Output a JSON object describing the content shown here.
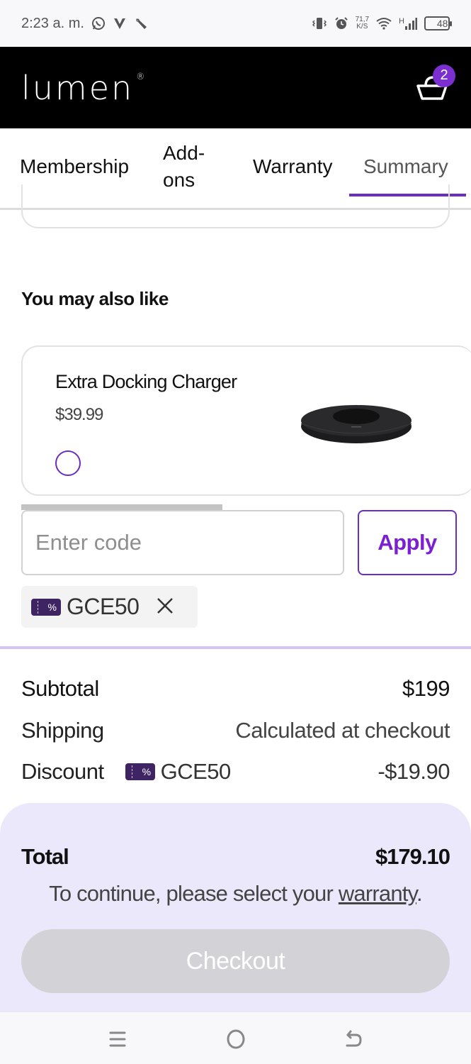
{
  "status_bar": {
    "time": "2:23 a. m.",
    "left_icons": [
      "whatsapp-icon",
      "vivaldi-icon",
      "wrench-icon"
    ],
    "right_icons": [
      "vibrate-icon",
      "alarm-icon",
      "wifi-icon",
      "signal-icon"
    ],
    "network_speed_value": "71,7",
    "network_speed_unit": "K/S",
    "network_type": "H",
    "battery_level": "48"
  },
  "header": {
    "logo_text": "lumen",
    "logo_mark": "®",
    "cart_count": "2",
    "cart_icon": "basket-icon"
  },
  "tabs": [
    {
      "label": "Membership",
      "active": false
    },
    {
      "label": "Add-ons",
      "label_line1": "Add-",
      "label_line2": "ons",
      "active": false
    },
    {
      "label": "Warranty",
      "active": false
    },
    {
      "label": "Summary",
      "active": true
    }
  ],
  "recommendations": {
    "title": "You may also like",
    "items": [
      {
        "name": "Extra Docking Charger",
        "price": "$39.99",
        "selected": false,
        "image": "docking-charger-image"
      }
    ],
    "scroll_position": 0.47
  },
  "promo": {
    "input_placeholder": "Enter code",
    "input_value": "",
    "apply_label": "Apply",
    "applied_code": "GCE50",
    "tag_glyph": "%"
  },
  "summary": {
    "subtotal_label": "Subtotal",
    "subtotal_value": "$199",
    "shipping_label": "Shipping",
    "shipping_value": "Calculated at checkout",
    "discount_label": "Discount",
    "discount_code": "GCE50",
    "discount_value": "-$19.90"
  },
  "footer": {
    "total_label": "Total",
    "total_value": "$179.10",
    "continue_prefix": "To continue, please select your ",
    "continue_link": "warranty",
    "continue_suffix": ".",
    "checkout_label": "Checkout",
    "checkout_enabled": false
  },
  "colors": {
    "accent": "#6a2ec0",
    "apply_text": "#7b1fd0",
    "badge": "#7b2fd0",
    "tag_bg": "#3e2463",
    "sheet_bg": "#ece8fc",
    "divider": "#d8c4f2",
    "checkout_disabled": "#d3d2d7"
  },
  "nav_bar": {
    "buttons": [
      "recents-icon",
      "home-icon",
      "back-icon"
    ]
  }
}
